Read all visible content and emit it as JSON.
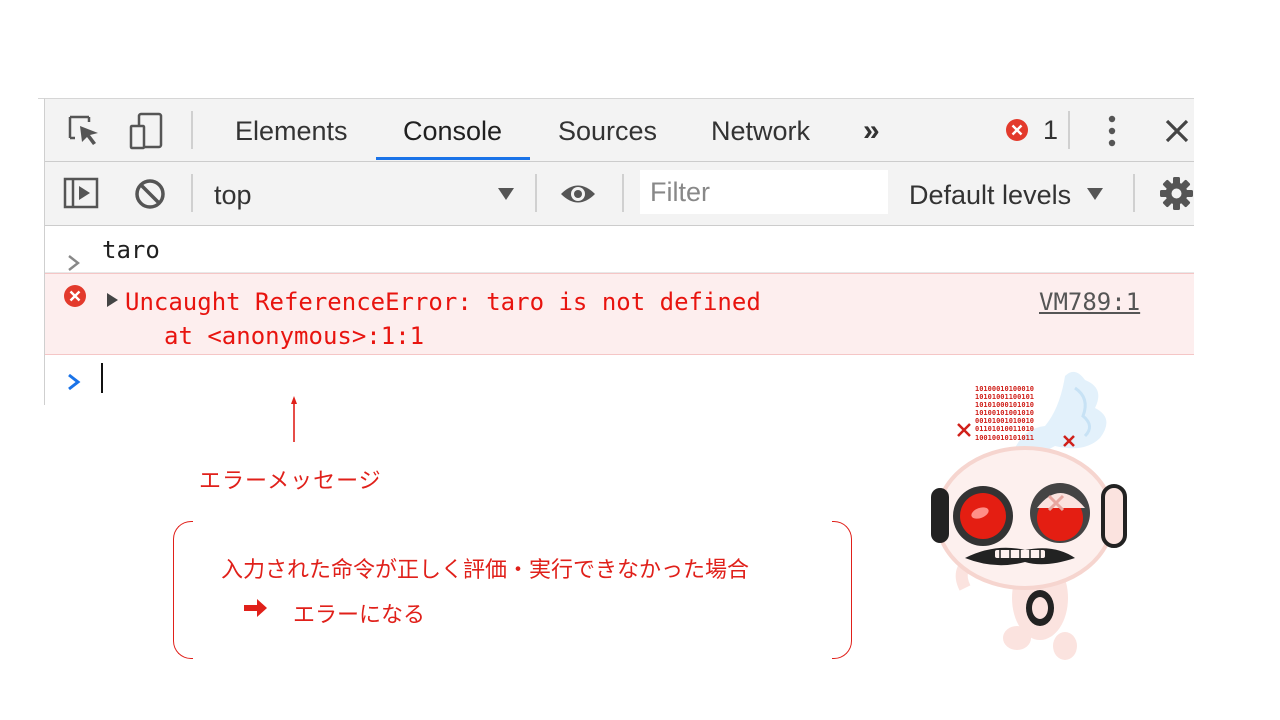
{
  "devtools": {
    "tabs": [
      {
        "label": "Elements",
        "active": false
      },
      {
        "label": "Console",
        "active": true
      },
      {
        "label": "Sources",
        "active": false
      },
      {
        "label": "Network",
        "active": false
      }
    ],
    "more_tabs_label": "»",
    "error_count": "1",
    "toolbar": {
      "context": "top",
      "filter_placeholder": "Filter",
      "levels_label": "Default levels"
    },
    "console": {
      "input_command": "taro",
      "error_message": "Uncaught ReferenceError: taro is not defined",
      "error_stack": "at <anonymous>:1:1",
      "error_source": "VM789:1",
      "prompt_symbol": ">"
    },
    "colors": {
      "accent": "#1a73e8",
      "error_text": "#e8140f",
      "error_bg": "#fdeeee"
    }
  },
  "annotation": {
    "label": "エラーメッセージ",
    "box_line1": "入力された命令が正しく評価・実行できなかった場合",
    "box_line2": "エラーになる",
    "color": "#e0201a"
  },
  "robot": {
    "binary_lines": [
      "1010001010001 0",
      "10101001100101",
      "10101000101010",
      "10100101001010",
      "00101001010010",
      "01101010011010",
      "10010010101011"
    ]
  }
}
